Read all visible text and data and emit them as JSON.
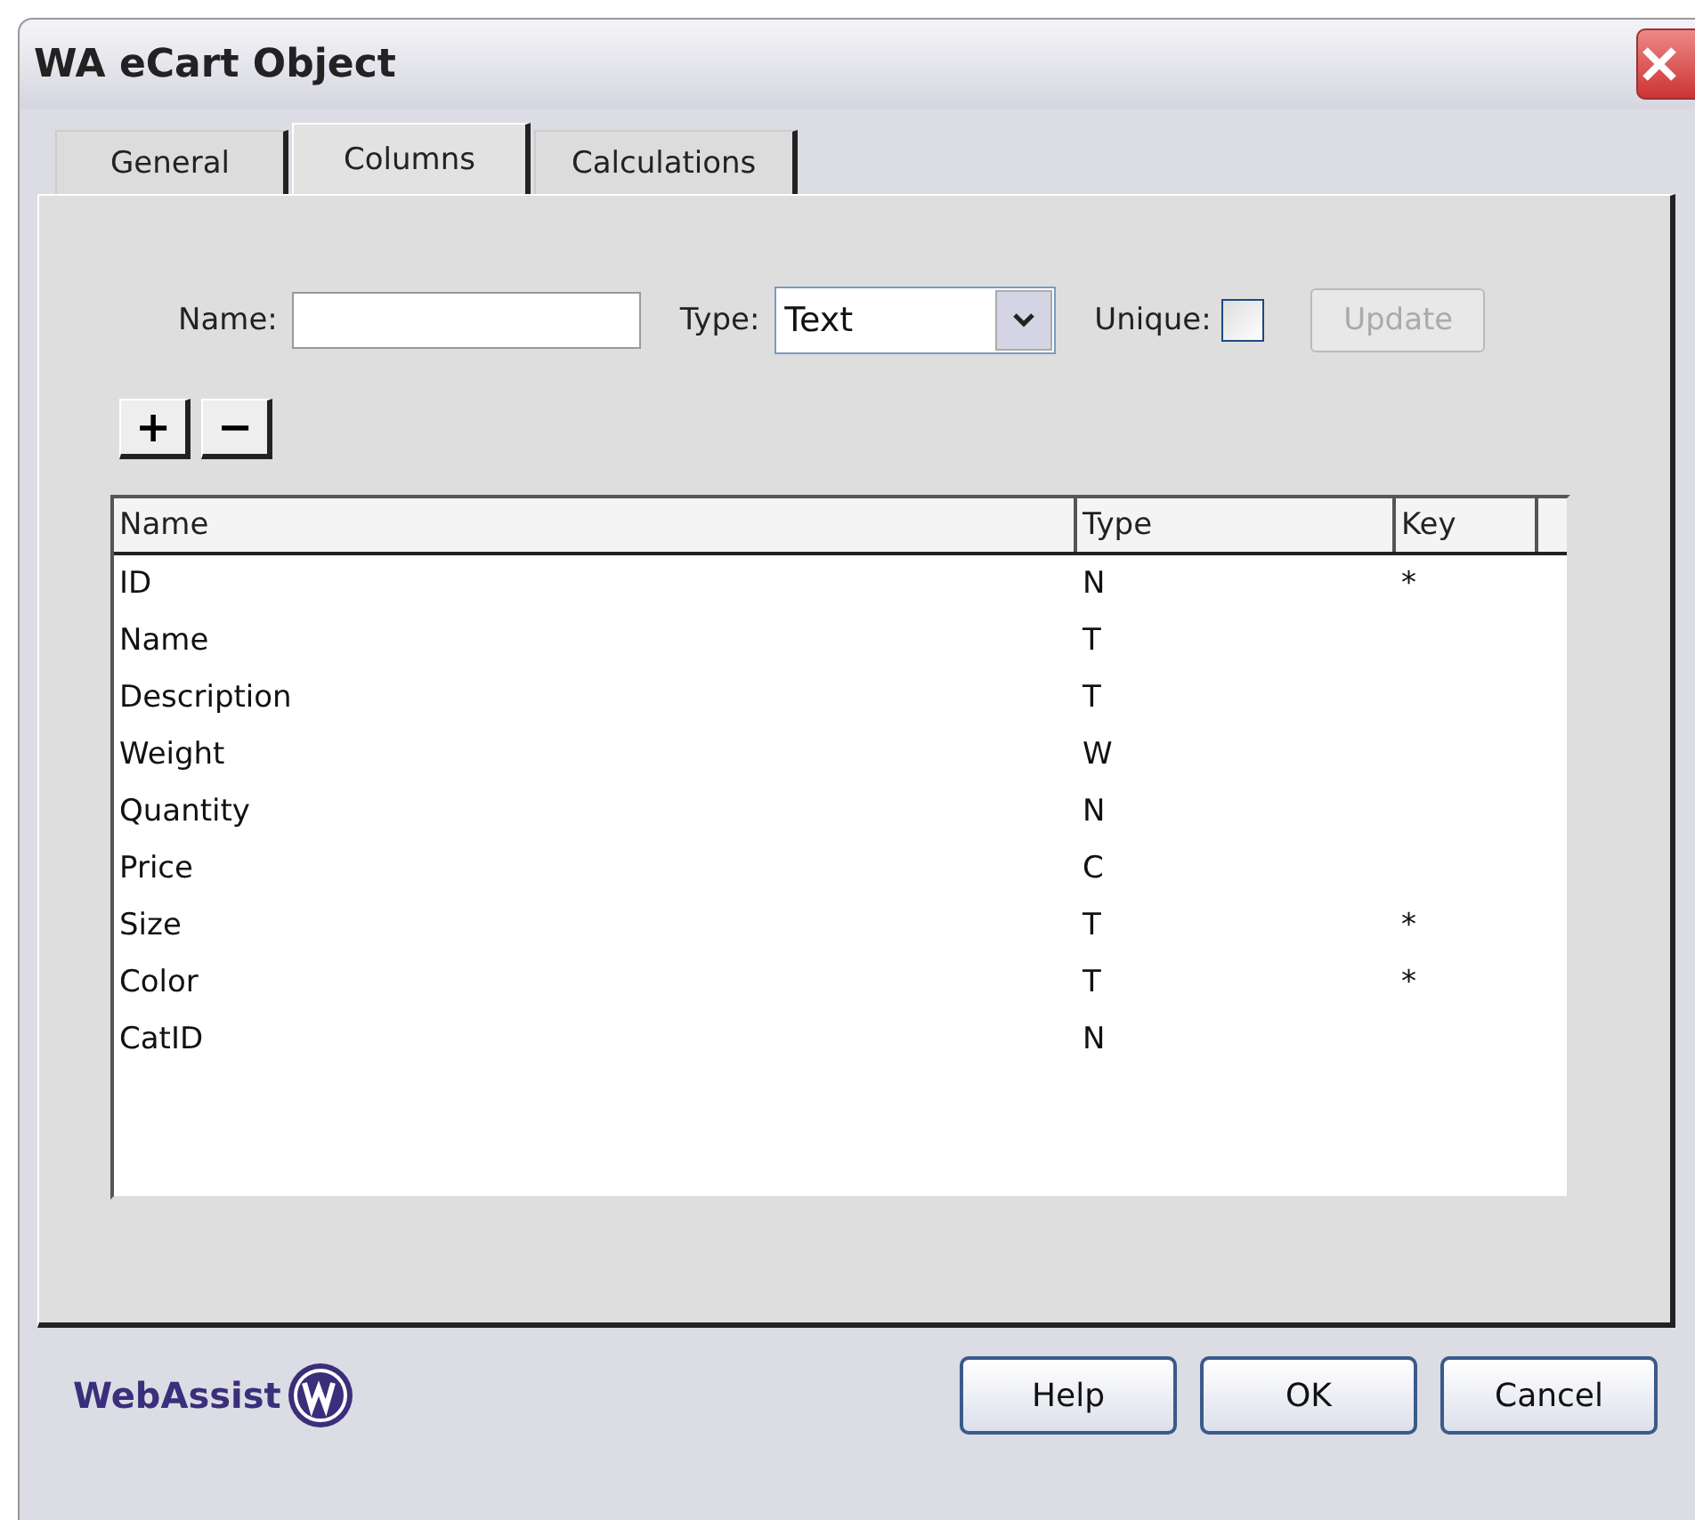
{
  "window": {
    "title": "WA eCart Object"
  },
  "tabs": [
    {
      "label": "General",
      "selected": false
    },
    {
      "label": "Columns",
      "selected": true
    },
    {
      "label": "Calculations",
      "selected": false
    }
  ],
  "form": {
    "name_label": "Name:",
    "type_label": "Type:",
    "type_value": "Text",
    "unique_label": "Unique:",
    "unique_checked": false,
    "update": {
      "label": "Update",
      "disabled": true
    }
  },
  "list_buttons": [
    "+",
    "−"
  ],
  "table": {
    "columns": [
      "Name",
      "Type",
      "Key"
    ],
    "rows": [
      [
        "ID",
        "N",
        "*"
      ],
      [
        "Name",
        "T",
        ""
      ],
      [
        "Description",
        "T",
        ""
      ],
      [
        "Weight",
        "W",
        ""
      ],
      [
        "Quantity",
        "N",
        ""
      ],
      [
        "Price",
        "C",
        ""
      ],
      [
        "Size",
        "T",
        "*"
      ],
      [
        "Color",
        "T",
        "*"
      ],
      [
        "CatID",
        "N",
        ""
      ]
    ]
  },
  "footer": {
    "logo": "WebAssist",
    "buttons": [
      "Help",
      "OK",
      "Cancel"
    ]
  }
}
